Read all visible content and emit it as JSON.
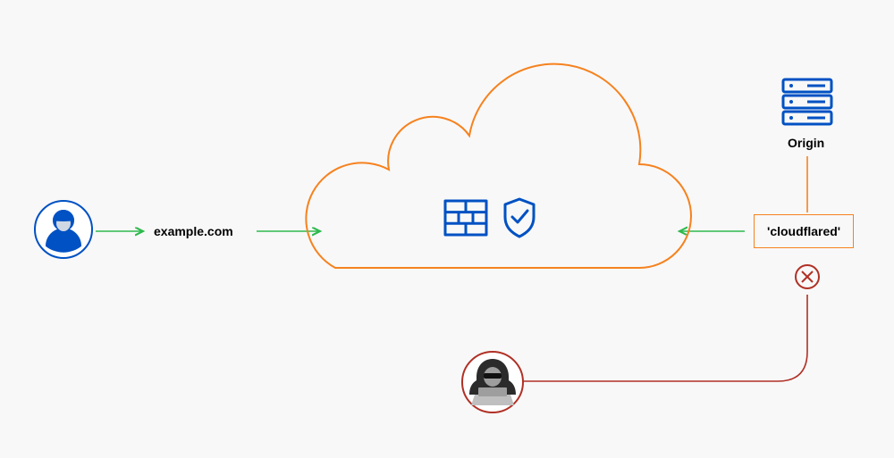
{
  "domain_label": "example.com",
  "origin_label": "Origin",
  "cloudflared_label": "'cloudflared'",
  "colors": {
    "blue": "#0051c3",
    "orange": "#f6821f",
    "green": "#2db94d",
    "red": "#b03025",
    "grey": "#4a4a4a"
  }
}
